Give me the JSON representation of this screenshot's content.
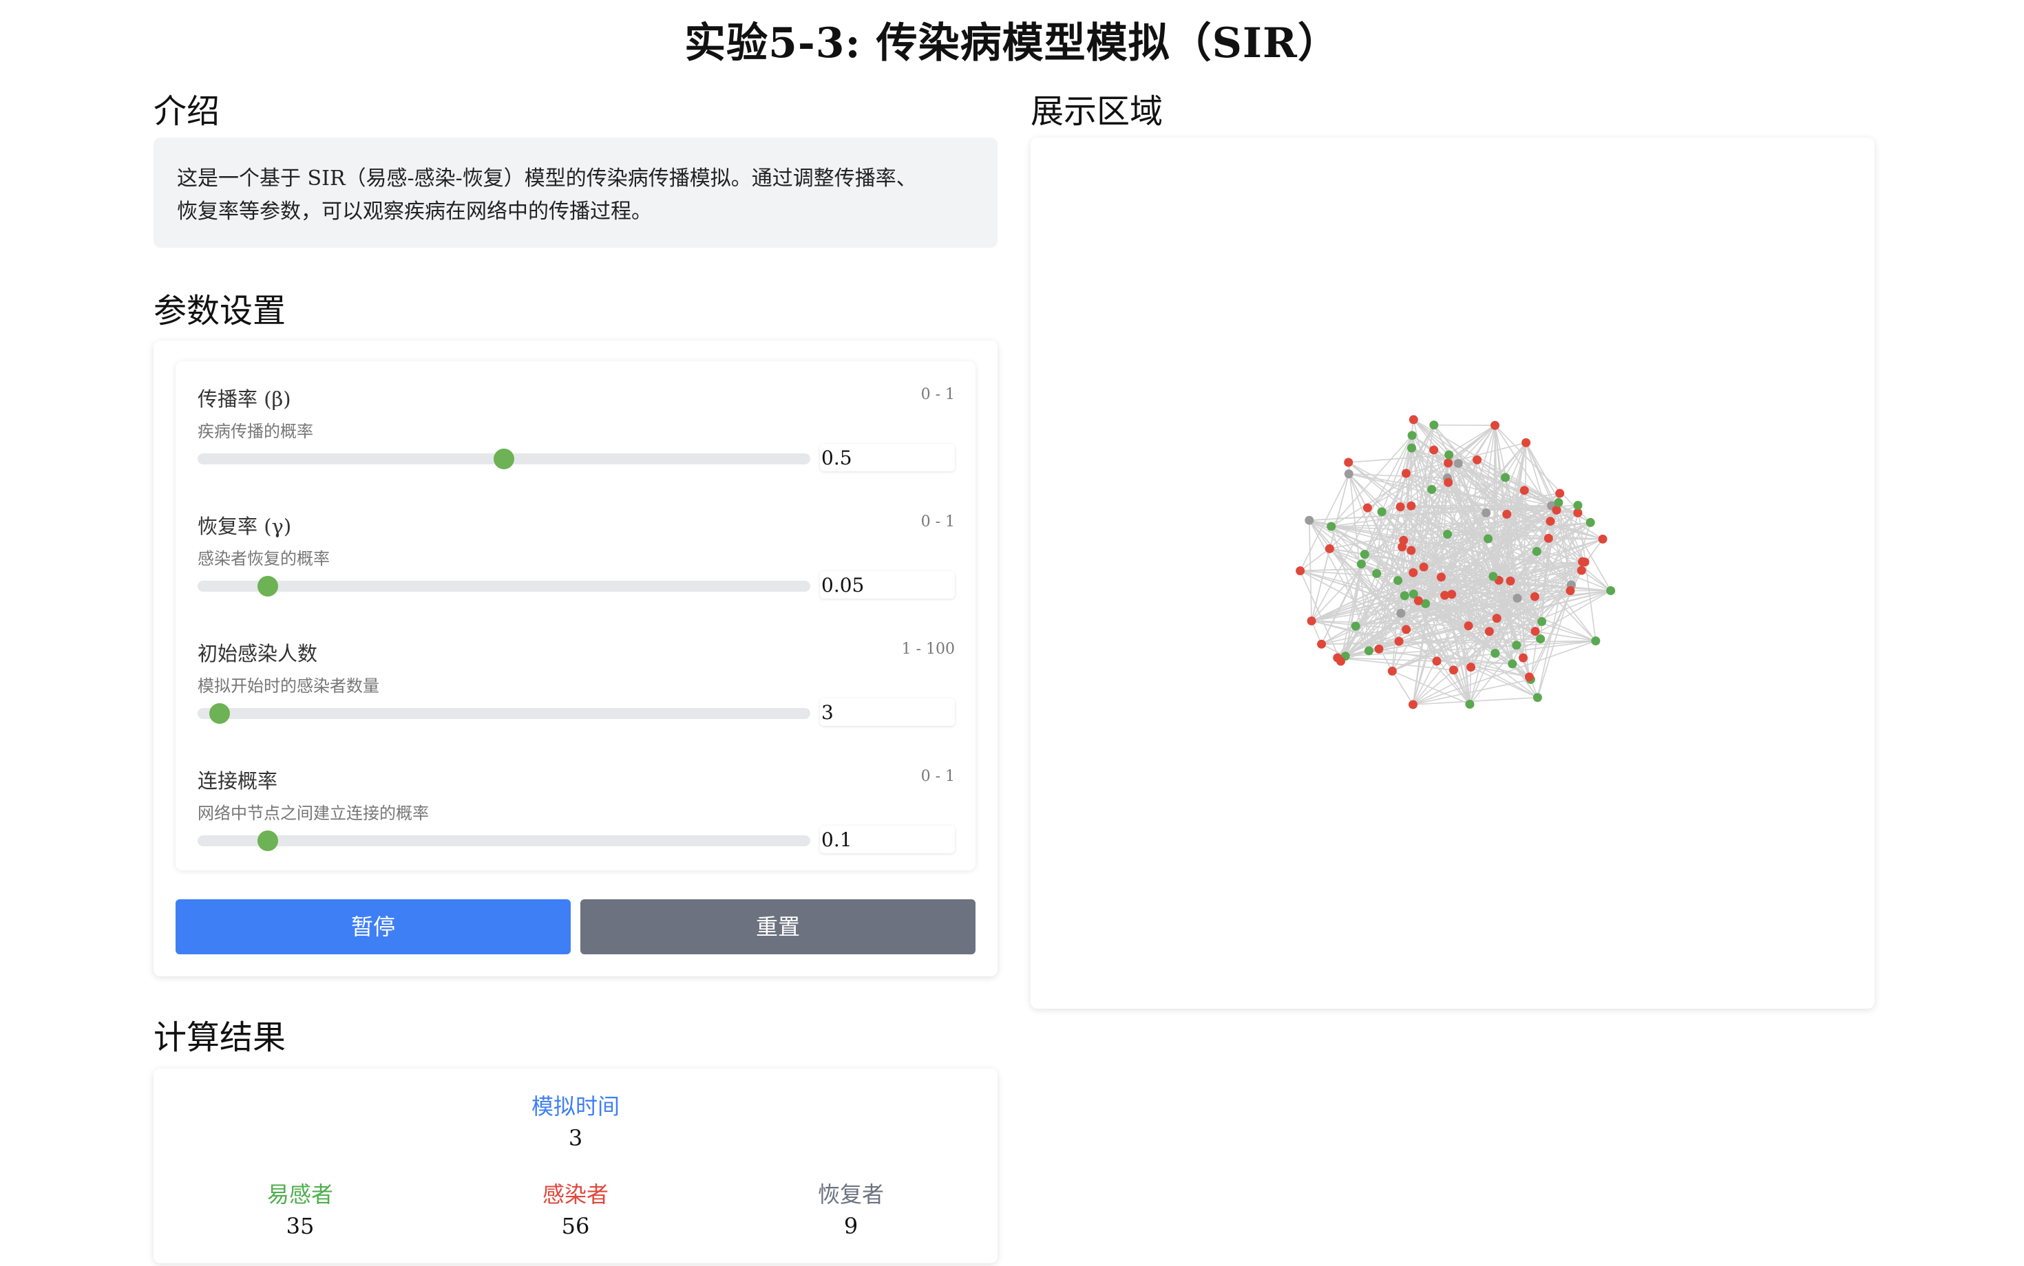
{
  "title": "实验5-3: 传染病模型模拟（SIR）",
  "intro": {
    "heading": "介绍",
    "text_line1": "这是一个基于 SIR（易感-感染-恢复）模型的传染病传播模拟。通过调整传播率、",
    "text_line2": "恢复率等参数，可以观察疾病在网络中的传播过程。"
  },
  "params": {
    "heading": "参数设置",
    "items": [
      {
        "label": "传播率 (β)",
        "desc": "疾病传播的概率",
        "range": "0 - 1",
        "value": "0.5",
        "fraction": 0.5
      },
      {
        "label": "恢复率 (γ)",
        "desc": "感染者恢复的概率",
        "range": "0 - 1",
        "value": "0.05",
        "fraction": 0.115
      },
      {
        "label": "初始感染人数",
        "desc": "模拟开始时的感染者数量",
        "range": "1 - 100",
        "value": "3",
        "fraction": 0.036
      },
      {
        "label": "连接概率",
        "desc": "网络中节点之间建立连接的概率",
        "range": "0 - 1",
        "value": "0.1",
        "fraction": 0.115
      }
    ],
    "pause_label": "暂停",
    "reset_label": "重置"
  },
  "results": {
    "heading": "计算结果",
    "time_label": "模拟时间",
    "time_value": "3",
    "susceptible_label": "易感者",
    "susceptible_value": "35",
    "infected_label": "感染者",
    "infected_value": "56",
    "recovered_label": "恢复者",
    "recovered_value": "9"
  },
  "display": {
    "heading": "展示区域"
  },
  "colors": {
    "susceptible": "#5aa84f",
    "infected": "#e0473b",
    "recovered": "#9b9b9b",
    "accent": "#3f7ff6",
    "edge": "#d2d2d2"
  }
}
